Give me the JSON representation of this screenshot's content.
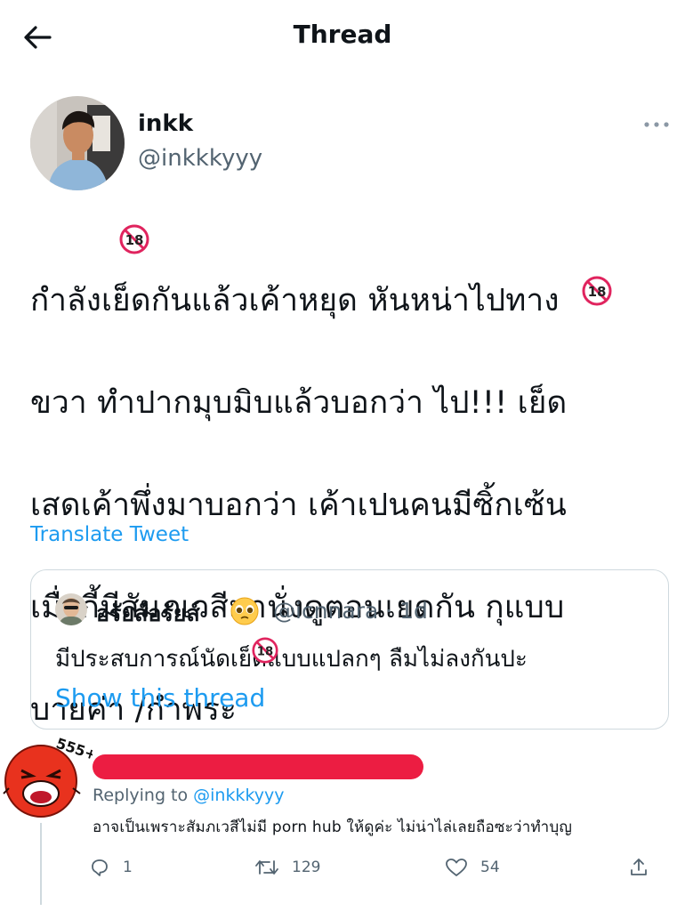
{
  "header": {
    "title": "Thread"
  },
  "author": {
    "name": "inkk",
    "handle": "@inkkkyyy"
  },
  "tweet": {
    "lines": [
      "กำลังเย็ดกันแล้วเค้าหยุด หันหน่าไปทาง",
      "ขวา ทำปากมุบมิบแล้วบอกว่า ไป!!! เย็ด",
      "เสดเค้าพึ่งมาบอกว่า เค้าเปนคนมีซิ้กเซ้น",
      "เมื่อกี้มีสัมภเวสีมานั่งดูตอนเยดกัน กุแบบ",
      "บายค่า /กำพระ"
    ],
    "censor_badge": "18",
    "translate_label": "Translate Tweet"
  },
  "quote": {
    "name": "อรัยส์อรัยส์",
    "handle_time": "@icnnara · 1d",
    "text": "มีประสบการณ์นัดเย็ดแบบแปลกๆ ลืมไม่ลงกันปะ",
    "show_thread": "Show this thread"
  },
  "reply": {
    "sticker_text": "555+",
    "replying_prefix": "Replying to ",
    "replying_handle": "@inkkkyyy",
    "text": "อาจเป็นเพราะสัมภเวสีไม่มี porn hub ให้ดูค่ะ ไม่น่าไล่เลยถือซะว่าทำบุญ",
    "counts": {
      "replies": "1",
      "retweets": "129",
      "likes": "54"
    }
  },
  "icons": [
    "back-arrow-icon",
    "more-icon",
    "censor-18-icon",
    "pleading-emoji-icon",
    "reply-icon",
    "retweet-icon",
    "like-icon",
    "share-icon"
  ]
}
